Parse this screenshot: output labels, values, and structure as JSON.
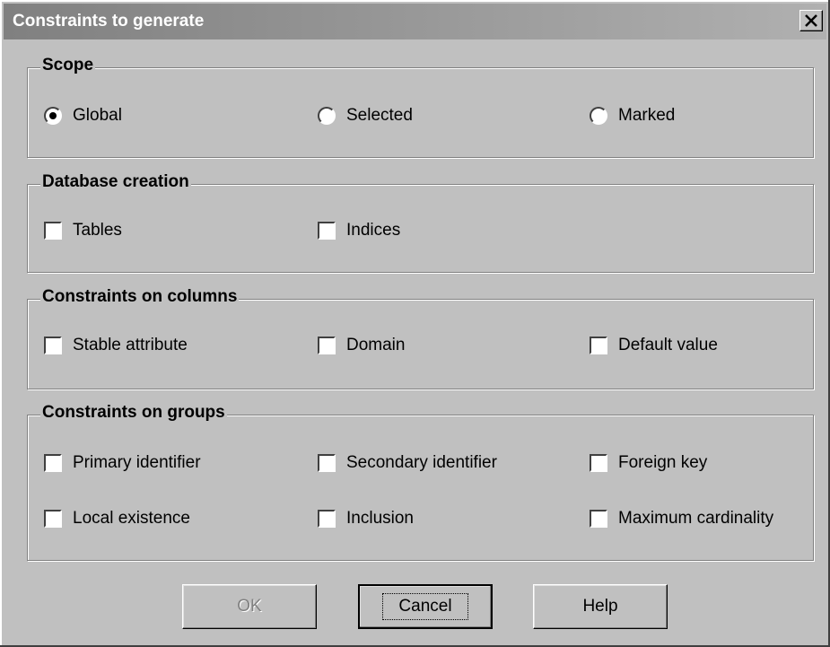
{
  "window": {
    "title": "Constraints to generate"
  },
  "scope": {
    "legend": "Scope",
    "options": [
      {
        "label": "Global",
        "selected": true
      },
      {
        "label": "Selected",
        "selected": false
      },
      {
        "label": "Marked",
        "selected": false
      }
    ]
  },
  "database_creation": {
    "legend": "Database creation",
    "options": [
      {
        "label": "Tables",
        "checked": false
      },
      {
        "label": "Indices",
        "checked": false
      }
    ]
  },
  "columns": {
    "legend": "Constraints on columns",
    "options": [
      {
        "label": "Stable attribute",
        "checked": false
      },
      {
        "label": "Domain",
        "checked": false
      },
      {
        "label": "Default value",
        "checked": false
      }
    ]
  },
  "groups": {
    "legend": "Constraints on groups",
    "options": [
      {
        "label": "Primary identifier",
        "checked": false
      },
      {
        "label": "Secondary identifier",
        "checked": false
      },
      {
        "label": "Foreign key",
        "checked": false
      },
      {
        "label": "Local existence",
        "checked": false
      },
      {
        "label": "Inclusion",
        "checked": false
      },
      {
        "label": "Maximum cardinality",
        "checked": false
      }
    ]
  },
  "buttons": {
    "ok": "OK",
    "cancel": "Cancel",
    "help": "Help",
    "ok_enabled": false
  }
}
